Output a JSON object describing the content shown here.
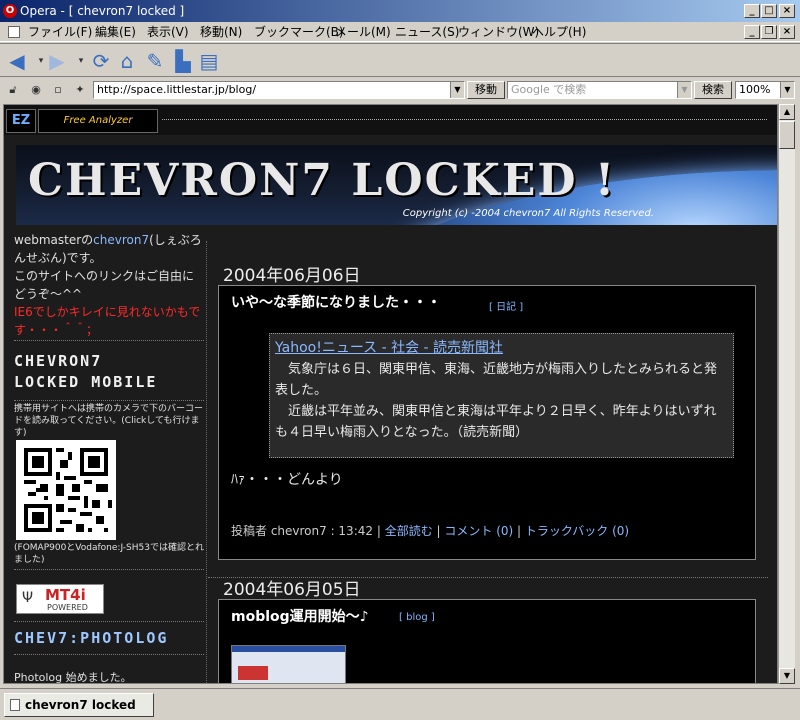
{
  "window": {
    "title": "Opera - [ chevron7 locked ]",
    "app_icon_glyph": "O"
  },
  "menu": [
    "ファイル(F)",
    "編集(E)",
    "表示(V)",
    "移動(N)",
    "ブックマーク(B)",
    "メール(M)",
    "ニュース(S)",
    "ウィンドウ(W)",
    "ヘルプ(H)"
  ],
  "toolbar": {
    "icons": [
      "back-icon",
      "forward-icon",
      "reload-icon",
      "home-icon",
      "hotlist-icon",
      "print-icon",
      "new-page-icon"
    ]
  },
  "address": {
    "url": "http://space.littlestar.jp/blog/",
    "go_label": "移動",
    "search_placeholder": "Google で検索",
    "search_label": "検索",
    "zoom": "100%"
  },
  "site": {
    "ez_logo": "EZ",
    "free_analyzer": "Free Analyzer",
    "banner_title": "CHEVRON7 LOCKED !",
    "banner_copy": "Copyright (c) -2004 chevron7 All Rights Reserved."
  },
  "sidebar": {
    "intro_prefix": "webmasterの",
    "intro_name": "chevron7",
    "intro_suffix": "(しぇぶろんせぶん)です。",
    "intro_line2": "このサイトへのリンクはご自由にどうぞ～^^",
    "ie_warning": "IE6でしかキレイに見れないかもです・・・＾＾；",
    "mobile_head_1": "CHEVRON7",
    "mobile_head_2": "LOCKED MOBILE",
    "mobile_desc": "携帯用サイトへは携帯のカメラで下のバーコードを読み取ってください。(Clickしても行けます)",
    "mobile_note": "(FOMAP900とVodafone:J-SH53では確認とれました)",
    "mt4i_label": "MT4i",
    "mt4i_sub": "POWERED",
    "photolog_head": "CHEV7:PHOTOLOG",
    "photolog_text": "Photolog 始めました。"
  },
  "posts": [
    {
      "date": "2004年06月06日",
      "title": "いや～な季節になりました・・・",
      "category": "日記",
      "quote_link": "Yahoo!ニュース - 社会 - 読売新聞社",
      "quote_p1": "　気象庁は６日、関東甲信、東海、近畿地方が梅雨入りしたとみられると発表した。",
      "quote_p2": "　近畿は平年並み、関東甲信と東海は平年より２日早く、昨年よりはいずれも４日早い梅雨入りとなった。（読売新聞）",
      "body": "ﾊｧ・・・どんより",
      "footer_prefix": "投稿者 chevron7 : 13:42 | ",
      "read_all": "全部読む",
      "comments": "コメント (0)",
      "trackback": "トラックバック (0)"
    },
    {
      "date": "2004年06月05日",
      "title": "moblog運用開始～♪",
      "category": "blog"
    }
  ],
  "status": {
    "tab_title": "chevron7 locked"
  }
}
